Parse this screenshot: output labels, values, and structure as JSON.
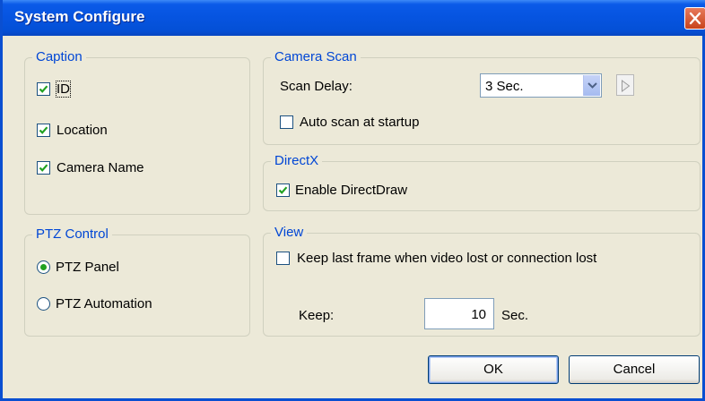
{
  "window": {
    "title": "System Configure",
    "close_icon": "close-icon"
  },
  "caption": {
    "legend": "Caption",
    "items": [
      {
        "label": "ID",
        "checked": true
      },
      {
        "label": "Location",
        "checked": true
      },
      {
        "label": "Camera Name",
        "checked": true
      }
    ]
  },
  "ptz": {
    "legend": "PTZ Control",
    "options": [
      {
        "label": "PTZ Panel",
        "selected": true
      },
      {
        "label": "PTZ Automation",
        "selected": false
      }
    ]
  },
  "camera_scan": {
    "legend": "Camera Scan",
    "scan_delay_label": "Scan Delay:",
    "scan_delay_value": "3 Sec.",
    "auto_scan_label": "Auto scan at startup",
    "auto_scan_checked": false
  },
  "directx": {
    "legend": "DirectX",
    "enable_label": "Enable DirectDraw",
    "enable_checked": true
  },
  "view": {
    "legend": "View",
    "keep_last_label": "Keep last frame when video lost or connection lost",
    "keep_last_checked": false,
    "keep_label": "Keep:",
    "keep_value": "10",
    "unit_label": "Sec."
  },
  "buttons": {
    "ok": "OK",
    "cancel": "Cancel"
  },
  "colors": {
    "title_bar": "#0654e0",
    "group_label": "#0046d5",
    "dialog_bg": "#ece9d8"
  }
}
